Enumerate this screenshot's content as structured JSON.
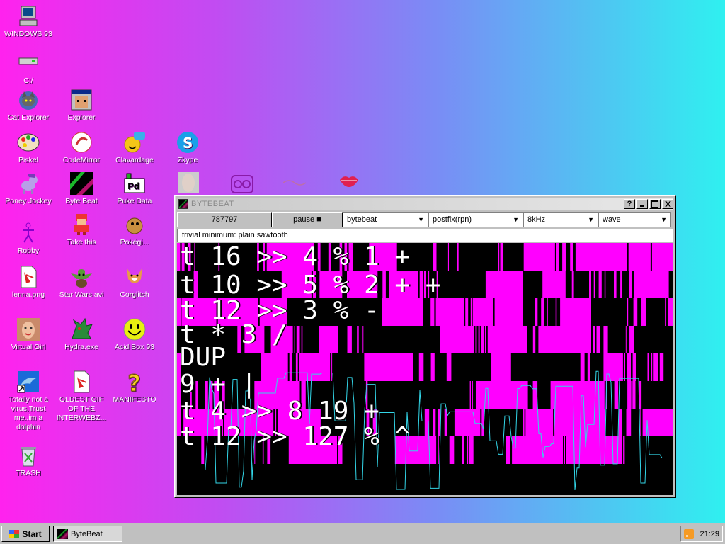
{
  "desktop": {
    "icons": [
      {
        "label": "WINDOWS 93",
        "icon": "computer-icon"
      },
      {
        "label": "C:/",
        "icon": "drive-icon"
      },
      {
        "label": "Cat Explorer",
        "icon": "cat-explorer-icon"
      },
      {
        "label": "Explorer",
        "icon": "explorer-icon"
      },
      {
        "label": "Piskel",
        "icon": "palette-icon"
      },
      {
        "label": "CodeMirror",
        "icon": "codemirror-icon"
      },
      {
        "label": "Clavardage",
        "icon": "chat-icon"
      },
      {
        "label": "Zkype",
        "icon": "zkype-icon"
      },
      {
        "label": "Poney Jockey",
        "icon": "pony-icon"
      },
      {
        "label": "Byte Beat",
        "icon": "bytebeat-icon"
      },
      {
        "label": "Puke Data",
        "icon": "puredata-icon"
      },
      {
        "label": "Robby",
        "icon": "robby-icon"
      },
      {
        "label": "Take this",
        "icon": "take-this-icon"
      },
      {
        "label": "Pokégi...",
        "icon": "pokegi-icon"
      },
      {
        "label": "lenna.png",
        "icon": "image-file-icon"
      },
      {
        "label": "Star Wars.avi",
        "icon": "yoda-icon"
      },
      {
        "label": "Corglitch",
        "icon": "corgi-icon"
      },
      {
        "label": "Virtual Girl",
        "icon": "virtual-girl-icon"
      },
      {
        "label": "Hydra.exe",
        "icon": "hydra-icon"
      },
      {
        "label": "Acid Box 93",
        "icon": "acid-smiley-icon"
      },
      {
        "label": "Totally not a virus.Trust me..im a dolphin",
        "icon": "dolphin-shortcut-icon"
      },
      {
        "label": "OLDEST GIF OF THE INTERWEBZ...",
        "icon": "gif-file-icon"
      },
      {
        "label": "MANIFESTO",
        "icon": "question-icon"
      },
      {
        "label": "TRASH",
        "icon": "trash-icon"
      }
    ]
  },
  "window": {
    "title": "BYTEBEAT",
    "help_label": "?",
    "toolbar": {
      "counter": "787797",
      "pause_label": "pause ■",
      "mode": "bytebeat",
      "notation": "postfix(rpn)",
      "rate": "8kHz",
      "view": "wave"
    },
    "info": "trivial minimum: plain sawtooth",
    "code_lines": [
      "t 16 >> 4 % 1 +",
      "t 10 >> 5 % 2 + +",
      "t 12 >> 3 % -",
      "t * 3 /",
      "DUP",
      "9 + |",
      "t 4 >> 8 19 +",
      "t 12 >> 127 % ^"
    ]
  },
  "taskbar": {
    "start_label": "Start",
    "task_label": "ByteBeat",
    "clock": "21:29"
  },
  "colors": {
    "magenta": "#ff00ff",
    "wave": "#33d6e8",
    "window_gray": "#c0c0c0"
  }
}
